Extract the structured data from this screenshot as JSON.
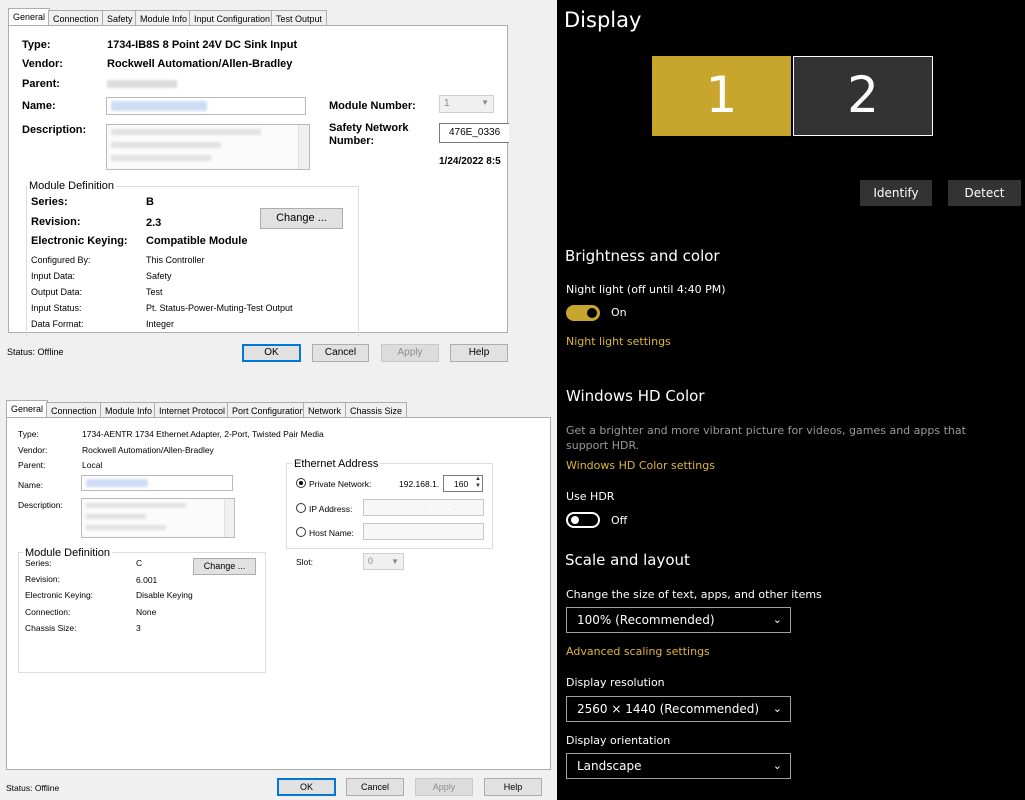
{
  "dialog1": {
    "tabs": [
      "General",
      "Connection",
      "Safety",
      "Module Info",
      "Input Configuration",
      "Test Output"
    ],
    "type_label": "Type:",
    "type_value": "1734-IB8S 8 Point 24V DC Sink Input",
    "vendor_label": "Vendor:",
    "vendor_value": "Rockwell Automation/Allen-Bradley",
    "parent_label": "Parent:",
    "name_label": "Name:",
    "description_label": "Description:",
    "module_number_label": "Module Number:",
    "module_number_value": "1",
    "safety_network_label_1": "Safety Network",
    "safety_network_label_2": "Number:",
    "safety_network_value": "476E_0336",
    "safety_network_date": "1/24/2022 8:5",
    "module_definition": {
      "title": "Module Definition",
      "series_label": "Series:",
      "series_value": "B",
      "revision_label": "Revision:",
      "revision_value": "2.3",
      "keying_label": "Electronic Keying:",
      "keying_value": "Compatible Module",
      "configured_by_label": "Configured By:",
      "configured_by_value": "This Controller",
      "input_data_label": "Input Data:",
      "input_data_value": "Safety",
      "output_data_label": "Output Data:",
      "output_data_value": "Test",
      "input_status_label": "Input Status:",
      "input_status_value": "Pt. Status-Power-Muting-Test Output",
      "data_format_label": "Data Format:",
      "data_format_value": "Integer",
      "change_button": "Change ..."
    },
    "status": "Status:  Offline",
    "ok": "OK",
    "cancel": "Cancel",
    "apply": "Apply",
    "help": "Help"
  },
  "dialog2": {
    "tabs": [
      "General",
      "Connection",
      "Module Info",
      "Internet Protocol",
      "Port Configuration",
      "Network",
      "Chassis Size"
    ],
    "type_label": "Type:",
    "type_value": "1734-AENTR 1734 Ethernet Adapter, 2-Port, Twisted Pair Media",
    "vendor_label": "Vendor:",
    "vendor_value": "Rockwell Automation/Allen-Bradley",
    "parent_label": "Parent:",
    "parent_value": "Local",
    "name_label": "Name:",
    "description_label": "Description:",
    "module_definition": {
      "title": "Module Definition",
      "series_label": "Series:",
      "series_value": "C",
      "revision_label": "Revision:",
      "revision_value": "6.001",
      "keying_label": "Electronic Keying:",
      "keying_value": "Disable Keying",
      "connection_label": "Connection:",
      "connection_value": "None",
      "chassis_label": "Chassis Size:",
      "chassis_value": "3",
      "change_button": "Change ..."
    },
    "ethernet": {
      "title": "Ethernet Address",
      "private_label": "Private Network:",
      "private_prefix": "192.168.1.",
      "private_value": "160",
      "ip_label": "IP Address:",
      "host_label": "Host Name:"
    },
    "slot_label": "Slot:",
    "slot_value": "0",
    "status": "Status:  Offline",
    "ok": "OK",
    "cancel": "Cancel",
    "apply": "Apply",
    "help": "Help"
  },
  "display": {
    "title": "Display",
    "monitor1": "1",
    "monitor2": "2",
    "identify": "Identify",
    "detect": "Detect",
    "brightness_heading": "Brightness and color",
    "night_light_label": "Night light (off until 4:40 PM)",
    "night_light_state": "On",
    "night_light_settings": "Night light settings",
    "hd_heading": "Windows HD Color",
    "hd_desc_1": "Get a brighter and more vibrant picture for videos, games and apps that",
    "hd_desc_2": "support HDR.",
    "hd_settings": "Windows HD Color settings",
    "use_hdr_label": "Use HDR",
    "use_hdr_state": "Off",
    "scale_heading": "Scale and layout",
    "scale_label": "Change the size of text, apps, and other items",
    "scale_value": "100% (Recommended)",
    "advanced_scaling": "Advanced scaling settings",
    "resolution_label": "Display resolution",
    "resolution_value": "2560 × 1440 (Recommended)",
    "orientation_label": "Display orientation",
    "orientation_value": "Landscape",
    "accent_color": "#c8a62e",
    "link_color": "#dcb63a"
  }
}
